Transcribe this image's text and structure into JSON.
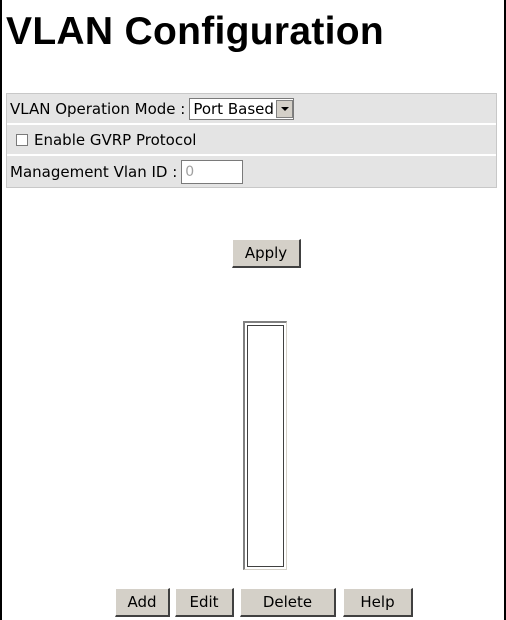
{
  "page": {
    "title": "VLAN Configuration"
  },
  "config": {
    "operation_mode_label": "VLAN Operation Mode :",
    "operation_mode_value": "Port Based",
    "gvrp_label": "Enable GVRP Protocol",
    "gvrp_checked": false,
    "mgmt_vlan_label": "Management Vlan ID :",
    "mgmt_vlan_value": "0"
  },
  "buttons": {
    "apply": "Apply",
    "add": "Add",
    "edit": "Edit",
    "delete": "Delete",
    "help": "Help"
  },
  "vlan_list": {
    "items": []
  }
}
